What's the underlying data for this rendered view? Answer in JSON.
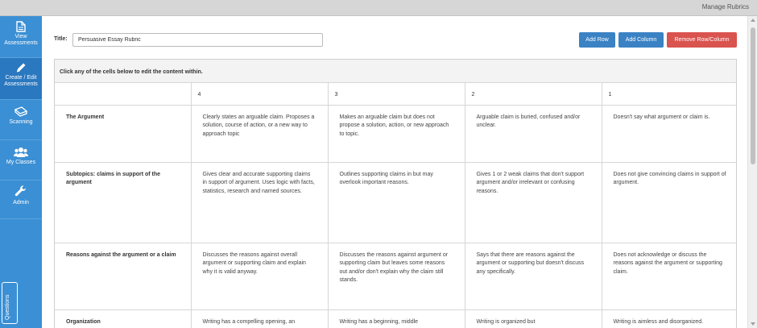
{
  "topbar": {
    "crumb": "Manage Rubrics"
  },
  "sidebar": {
    "items": [
      {
        "label": "View Assessments",
        "icon": "document-icon"
      },
      {
        "label": "Create / Edit Assessments",
        "icon": "pencil-icon"
      },
      {
        "label": "Scanning",
        "icon": "scanner-icon"
      },
      {
        "label": "My Classes",
        "icon": "users-icon"
      },
      {
        "label": "Admin",
        "icon": "wrench-icon"
      }
    ],
    "questions_tab": "Questions"
  },
  "form": {
    "title_label": "Title:",
    "title_value": "Persuasive Essay Rubric"
  },
  "toolbar": {
    "add_row": "Add Row",
    "add_column": "Add Column",
    "remove": "Remove Row/Column"
  },
  "rubric": {
    "instruction": "Click any of the cells below to edit the content within.",
    "columns": [
      "",
      "4",
      "3",
      "2",
      "1"
    ],
    "rows": [
      {
        "label": "The Argument",
        "cells": [
          "Clearly states an arguable claim. Proposes a solution, course of action, or a new way to approach topic",
          "Makes an arguable claim but does not propose a solution, action, or new approach to topic.",
          "Arguable claim is buried, confused and/or unclear.",
          "Doesn't say what argument or claim is."
        ]
      },
      {
        "label": "Subtopics: claims in support of the argument",
        "cells": [
          "Gives clear and accurate supporting claims in support of argument. Uses logic with facts, statistics, research and named sources.",
          "Outlines supporting claims in but may overlook important reasons.",
          "Gives 1 or 2 weak claims that don't support argument and/or irrelevant or confusing reasons.",
          "Does not give convincing claims in support of argument."
        ]
      },
      {
        "label": "Reasons against the argument or a claim",
        "cells": [
          "Discusses the reasons against overall argument or supporting claim and explain why it is valid anyway.",
          "Discusses the reasons against argument or supporting claim but leaves some reasons out and/or don't explain why the claim still stands.",
          "Says that there are reasons against the argument or supporting but doesn't discuss any specifically.",
          "Does not acknowledge or discuss the reasons against the argument or supporting claim."
        ]
      },
      {
        "label": "Organization",
        "cells": [
          "Writing has a compelling opening, an",
          "Writing has a beginning, middle",
          "Writing is organized but",
          "Writing is aimless and disorganized."
        ]
      }
    ]
  }
}
